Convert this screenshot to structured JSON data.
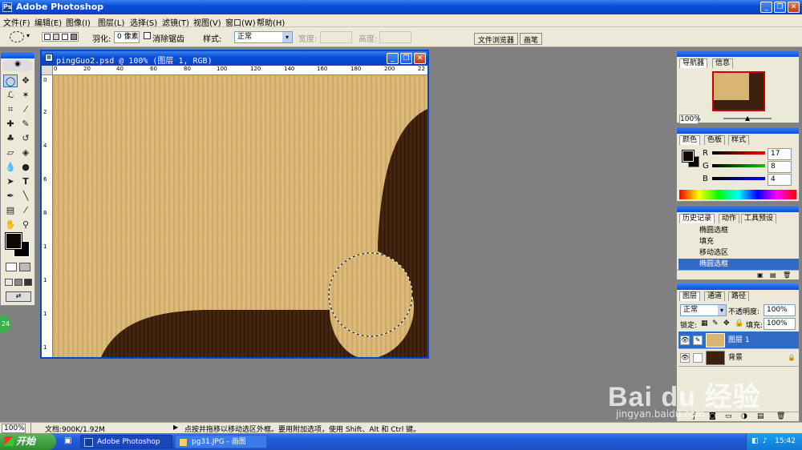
{
  "app": {
    "title": "Adobe Photoshop"
  },
  "menu": [
    "文件(F)",
    "编辑(E)",
    "图像(I)",
    "图层(L)",
    "选择(S)",
    "滤镜(T)",
    "视图(V)",
    "窗口(W)",
    "帮助(H)"
  ],
  "options": {
    "feather_label": "羽化:",
    "feather_value": "0 像素",
    "antialias_label": "消除锯齿",
    "style_label": "样式:",
    "style_value": "正常",
    "width_label": "宽度:",
    "height_label": "高度:",
    "tab_file_browser": "文件浏览器",
    "tab_brushes": "画笔"
  },
  "document": {
    "title": "pingGuo2.psd @ 100% (图层 1, RGB)",
    "ruler_top": [
      "0",
      "20",
      "40",
      "60",
      "80",
      "100",
      "120",
      "140",
      "160",
      "180",
      "200",
      "22"
    ],
    "ruler_left": [
      "0",
      "2",
      "4",
      "6",
      "8",
      "1",
      "1",
      "1",
      "1"
    ]
  },
  "navigator": {
    "tabs": [
      "导航器",
      "信息"
    ],
    "zoom": "100%"
  },
  "color": {
    "tabs": [
      "颜色",
      "色板",
      "样式"
    ],
    "r_label": "R",
    "g_label": "G",
    "b_label": "B",
    "r": "17",
    "g": "8",
    "b": "4"
  },
  "history": {
    "tabs": [
      "历史记录",
      "动作",
      "工具预设"
    ],
    "items": [
      "椭圆选框",
      "填充",
      "移动选区",
      "椭圆选框"
    ]
  },
  "layers": {
    "tabs": [
      "图层",
      "通道",
      "路径"
    ],
    "blend": "正常",
    "opacity_label": "不透明度:",
    "opacity": "100%",
    "lock_label": "锁定:",
    "fill_label": "填充:",
    "fill": "100%",
    "items": [
      "图层 1",
      "背景"
    ]
  },
  "status": {
    "zoom": "100%",
    "doc": "文档:900K/1.92M",
    "hint": "点按并拖移以移动选区外框。要用附加选项，使用 Shift、Alt 和 Ctrl 键。"
  },
  "taskbar": {
    "start": "开始",
    "items": [
      "Adobe Photoshop",
      "pg31.JPG - 画图"
    ],
    "time": "15:42"
  },
  "watermark": {
    "text": "Bai du 经验",
    "sub": "jingyan.baidu.com"
  },
  "colors": {
    "accent": "#0a4fd8",
    "light_wood": "#d9b574",
    "dark_wood": "#3b200d",
    "selection": "#316ac5"
  }
}
